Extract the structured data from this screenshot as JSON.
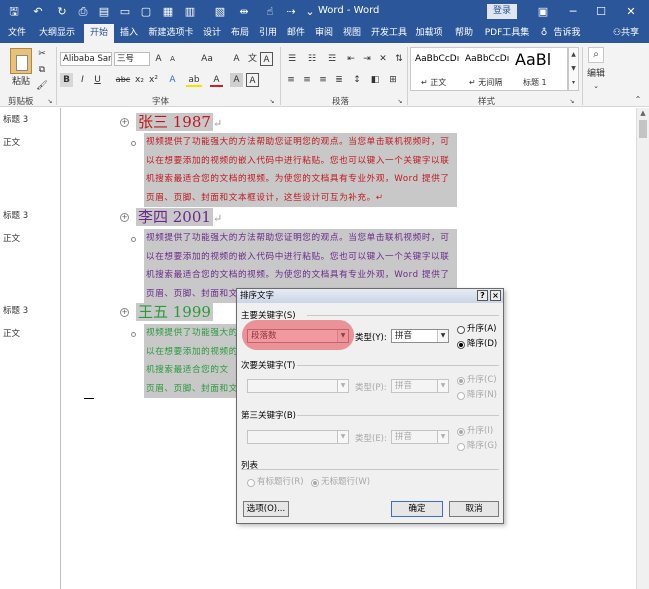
{
  "titlebar": {
    "title": "Word - Word",
    "login": "登录",
    "icons": [
      "save-icon",
      "undo-icon",
      "redo-icon",
      "print-preview-icon",
      "print-icon",
      "open-icon",
      "new-icon",
      "quick-print-icon",
      "table-icon",
      "indent-icon",
      "touch-icon",
      "customize-icon"
    ]
  },
  "tabs": [
    "文件",
    "大纲显示",
    "开始",
    "插入",
    "新建选项卡",
    "设计",
    "布局",
    "引用",
    "邮件",
    "审阅",
    "视图",
    "开发工具",
    "帮助",
    "加载项",
    "帮助",
    "PDF工具集"
  ],
  "tabs_right": {
    "tell_me": "告诉我",
    "share": "共享"
  },
  "active_tab": "开始",
  "ribbon": {
    "clipboard": {
      "paste": "粘贴",
      "label": "剪贴板"
    },
    "font": {
      "font_name": "Alibaba Sans",
      "font_size": "三号",
      "grow": "A",
      "shrink": "A",
      "case": "Aa",
      "clear": "A",
      "wen": "文",
      "bold": "B",
      "italic": "I",
      "underline": "U",
      "strike": "abc",
      "subscript": "x₂",
      "superscript": "x²",
      "text_effect": "A",
      "highlight": "ab",
      "font_color": "A",
      "char_shade": "A",
      "label": "字体"
    },
    "paragraph": {
      "label": "段落"
    },
    "styles": {
      "items": [
        {
          "sample": "AaBbCcDı",
          "name": "↵ 正文"
        },
        {
          "sample": "AaBbCcDı",
          "name": "↵ 无间隔"
        },
        {
          "sample": "AaBl",
          "name": "标题 1"
        }
      ],
      "label": "样式"
    },
    "editing": {
      "label": "编辑"
    }
  },
  "style_pane": [
    "标题 3",
    "正文",
    "标题 3",
    "正文",
    "标题 3",
    "正文"
  ],
  "document": {
    "sections": [
      {
        "heading": "张三 1987",
        "color": "#c0181e",
        "lines": [
          "视频提供了功能强大的方法帮助您证明您的观点。当您单击联机视频时，可",
          "以在想要添加的视频的嵌入代码中进行粘贴。您也可以键入一个关键字以联",
          "机搜索最适合您的文档的视频。为使您的文档具有专业外观，Word 提供了",
          "页眉、页脚、封面和文本框设计，这些设计可互为补充。↵"
        ]
      },
      {
        "heading": "李四 2001",
        "color": "#6a2a8c",
        "lines": [
          "视频提供了功能强大的方法帮助您证明您的观点。当您单击联机视频时，可",
          "以在想要添加的视频的嵌入代码中进行粘贴。您也可以键入一个关键字以联",
          "机搜索最适合您的文档的视频。为使您的文档具有专业外观，Word 提供了",
          "页眉、页脚、封面和文"
        ]
      },
      {
        "heading": "王五 1999",
        "color": "#2a9a3c",
        "lines": [
          "视频提供了功能强大的",
          "以在想要添加的视频的",
          "机搜索最适合您的文",
          "页眉、页脚、封面和文"
        ]
      }
    ],
    "para_mark": "↵"
  },
  "dialog": {
    "title": "排序文字",
    "help": "?",
    "close": "×",
    "primary": {
      "label": "主要关键字(S)",
      "key": "段落数",
      "type_label": "类型(Y):",
      "type": "拼音",
      "asc": "升序(A)",
      "desc": "降序(D)",
      "selected": "desc"
    },
    "secondary": {
      "label": "次要关键字(T)",
      "type_label": "类型(P):",
      "type": "拼音",
      "asc": "升序(C)",
      "desc": "降序(N)"
    },
    "tertiary": {
      "label": "第三关键字(B)",
      "type_label": "类型(E):",
      "type": "拼音",
      "asc": "升序(I)",
      "desc": "降序(G)"
    },
    "list": {
      "label": "列表",
      "has_header": "有标题行(R)",
      "no_header": "无标题行(W)"
    },
    "options": "选项(O)...",
    "ok": "确定",
    "cancel": "取消"
  },
  "colors": {
    "accent": "#2b579a",
    "highlight": "#e84650"
  }
}
